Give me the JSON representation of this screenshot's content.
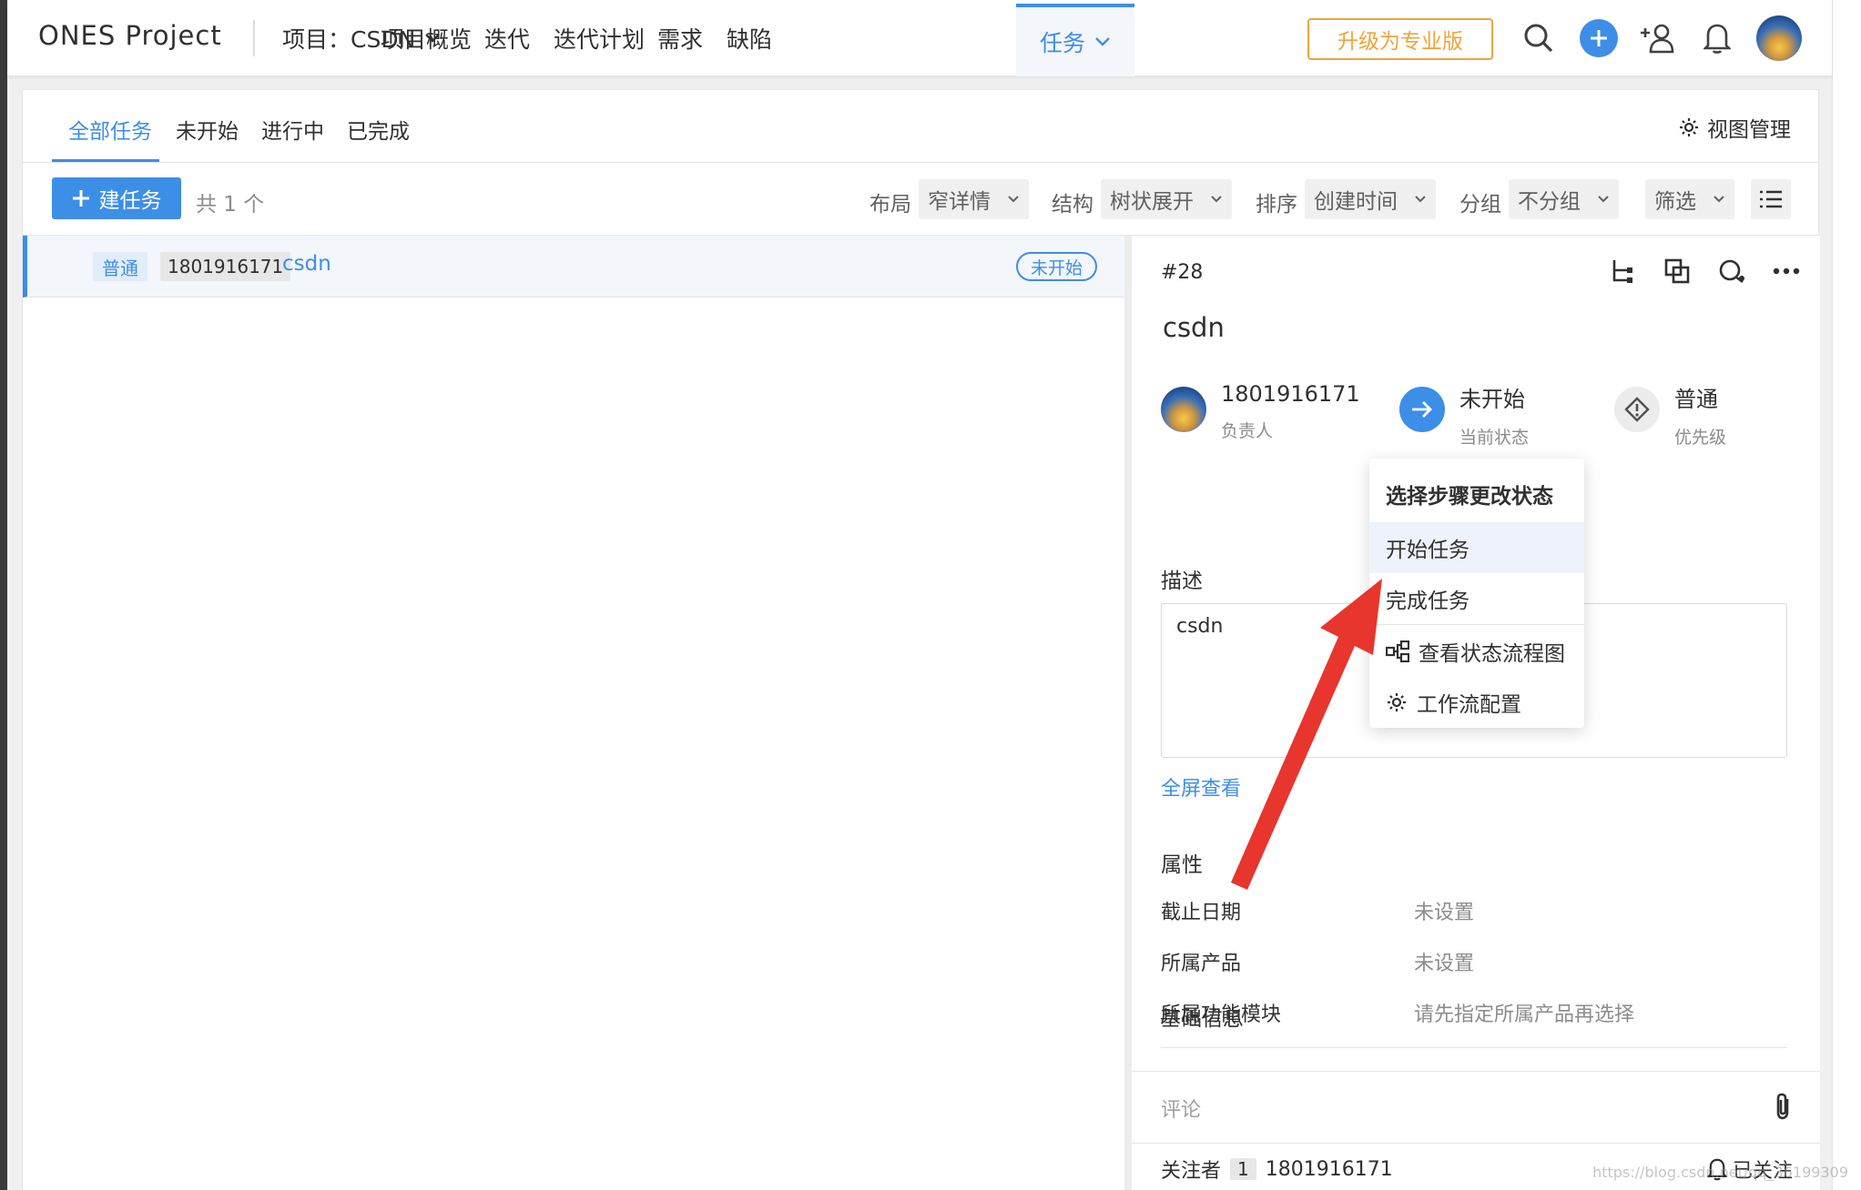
{
  "nav": {
    "logo": "ONES Project",
    "project": "项目：CSDN",
    "items": [
      "项目概览",
      "迭代",
      "迭代计划",
      "需求",
      "缺陷"
    ],
    "active": "任务",
    "upgrade": "升级为专业版"
  },
  "tabs": {
    "items": [
      "全部任务",
      "未开始",
      "进行中",
      "已完成"
    ],
    "view_manage": "视图管理"
  },
  "toolbar": {
    "new_task": "建任务",
    "count": "共 1 个",
    "layout_label": "布局",
    "layout_value": "窄详情",
    "structure_label": "结构",
    "structure_value": "树状展开",
    "sort_label": "排序",
    "sort_value": "创建时间",
    "group_label": "分组",
    "group_value": "不分组",
    "filter": "筛选"
  },
  "row": {
    "priority": "普通",
    "assignee": "1801916171",
    "title": "csdn",
    "status": "未开始"
  },
  "detail": {
    "number": "#28",
    "title": "csdn",
    "assignee": "1801916171",
    "assignee_label": "负责人",
    "status": "未开始",
    "status_label": "当前状态",
    "priority": "普通",
    "priority_label": "优先级",
    "desc_heading": "描述",
    "desc_text": "csdn",
    "fullscreen": "全屏查看",
    "props_heading": "属性",
    "props": [
      {
        "label": "截止日期",
        "value": "未设置"
      },
      {
        "label": "所属产品",
        "value": "未设置"
      },
      {
        "label": "所属功能模块",
        "value": "请先指定所属产品再选择"
      }
    ],
    "basic_heading": "基础信息",
    "comment_placeholder": "评论",
    "followers_label": "关注者",
    "followers_count": "1",
    "follower": "1801916171",
    "follow_status": "已关注"
  },
  "dropdown": {
    "title": "选择步骤更改状态",
    "items": [
      "开始任务",
      "完成任务",
      "查看状态流程图",
      "工作流配置"
    ]
  },
  "watermark": "https://blog.csdn.net/qq_36199309",
  "colors": {
    "accent": "#3d8ee6",
    "upgrade": "#f0a43a",
    "arrow": "#e8352d"
  }
}
